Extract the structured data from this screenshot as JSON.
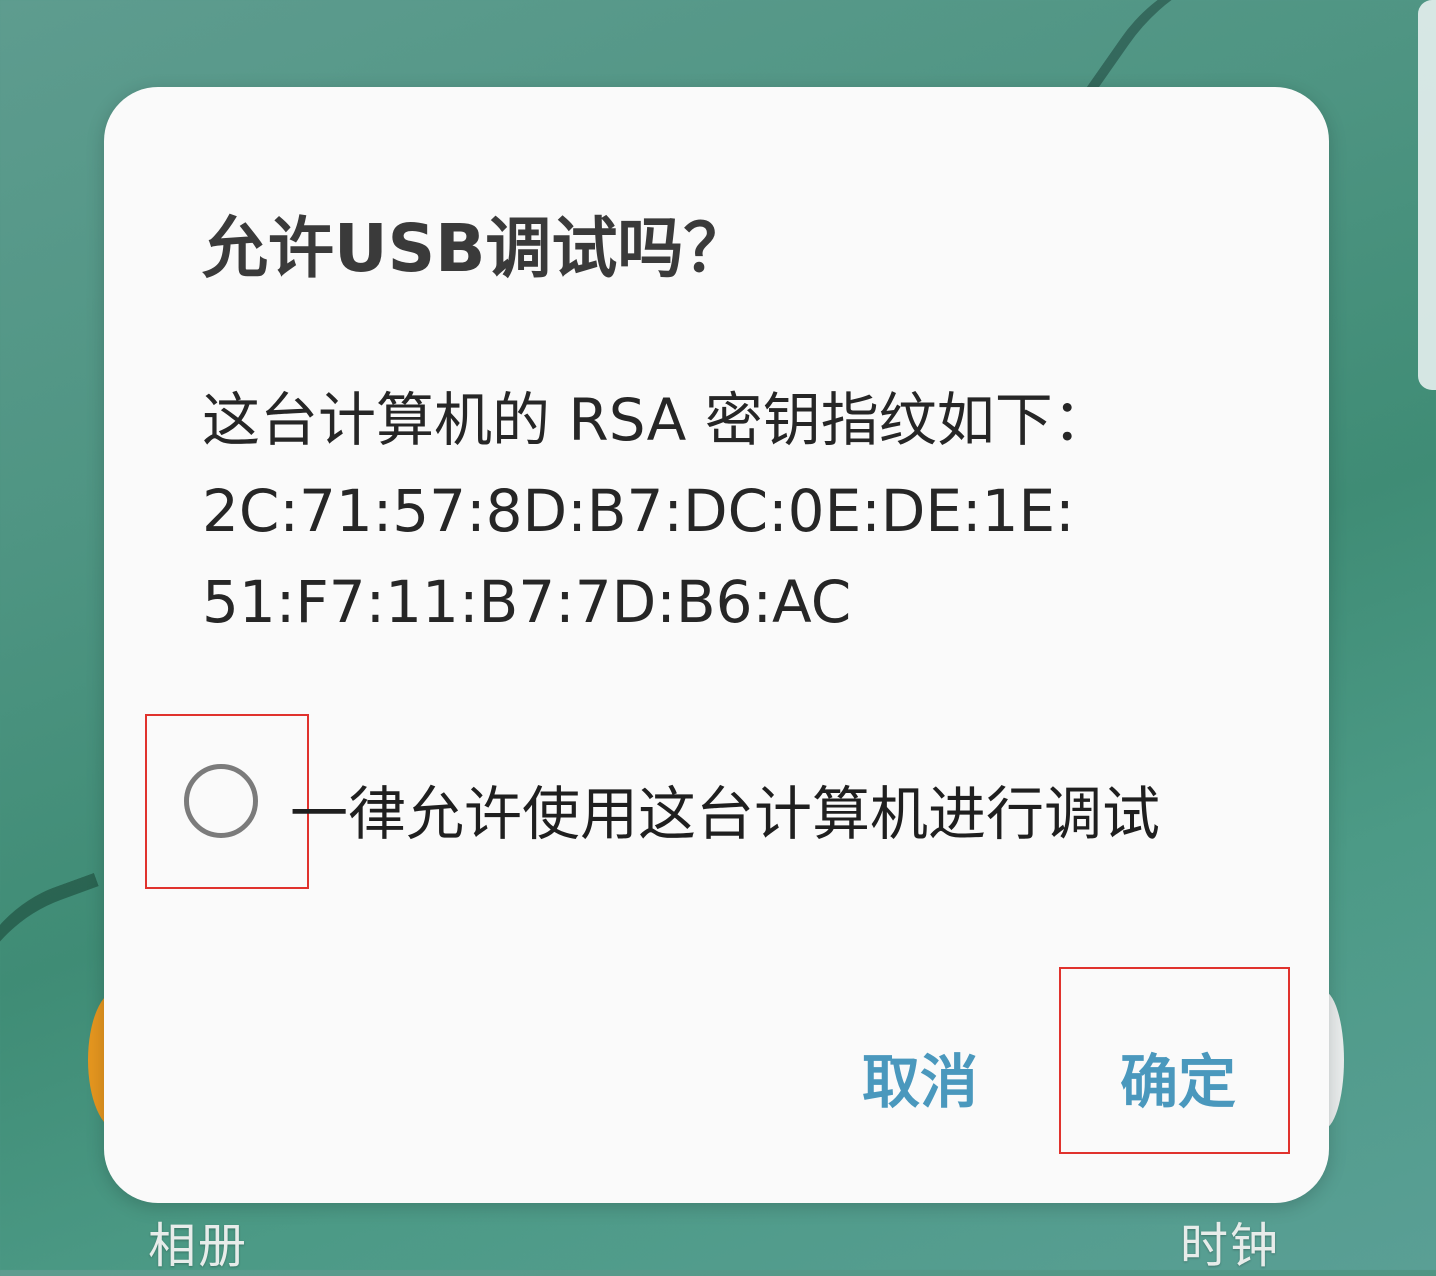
{
  "dialog": {
    "title": "允许USB调试吗？",
    "message_line1": "这台计算机的 RSA 密钥指纹如下：",
    "fingerprint_line1": "2C:71:57:8D:B7:DC:0E:DE:1E:",
    "fingerprint_line2": "51:F7:11:B7:7D:B6:AC",
    "always_allow_label": "一律允许使用这台计算机进行调试",
    "always_allow_checked": false,
    "cancel_label": "取消",
    "ok_label": "确定"
  },
  "home": {
    "left_app_label": "相册",
    "right_app_label": "时钟"
  },
  "colors": {
    "button_text": "#4a98bd",
    "highlight_box": "#e0322d",
    "dialog_bg": "#fafafa"
  },
  "icons": {
    "checkbox": "radio-circle-icon"
  }
}
